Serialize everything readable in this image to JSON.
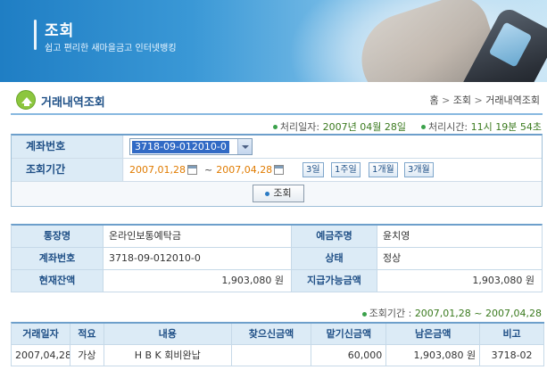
{
  "banner": {
    "title": "조회",
    "subtitle": "쉽고 편리한 새마을금고 인터넷뱅킹"
  },
  "page": {
    "title": "거래내역조회",
    "breadcrumb": {
      "home": "홈",
      "sep1": ">",
      "level1": "조회",
      "sep2": ">",
      "level2": "거래내역조회"
    }
  },
  "process": {
    "date_label": "처리일자:",
    "date_value": "2007년 04월 28일",
    "time_label": "처리시간:",
    "time_value": "11시 19분 54초"
  },
  "search": {
    "account_label": "계좌번호",
    "account_selected": "3718-09-012010-0",
    "period_label": "조회기간",
    "start_date": "2007,01,28",
    "tilde": "~",
    "end_date": "2007,04,28",
    "period_buttons": [
      "3일",
      "1주일",
      "1개월",
      "3개월"
    ],
    "query_button": "조회"
  },
  "account": {
    "passbook_label": "통장명",
    "passbook_value": "온라인보통예탁금",
    "owner_label": "예금주명",
    "owner_value": "윤치영",
    "account_label": "계좌번호",
    "account_value": "3718-09-012010-0",
    "status_label": "상태",
    "status_value": "정상",
    "balance_label": "현재잔액",
    "balance_value": "1,903,080 원",
    "available_label": "지급가능금액",
    "available_value": "1,903,080 원"
  },
  "period_line": {
    "label": "조회기간 :",
    "value": "2007,01,28 ~ 2007,04,28"
  },
  "transactions": {
    "headers": [
      "거래일자",
      "적요",
      "내용",
      "찾으신금액",
      "맡기신금액",
      "남은금액",
      "비고"
    ],
    "rows": [
      [
        "2007,04,28",
        "가상",
        "H B K 회비완납",
        "",
        "60,000",
        "1,903,080 원",
        "3718-02"
      ]
    ]
  },
  "colors": {
    "accent": "#1d4f86",
    "header_bg": "#dcebf6",
    "date_orange": "#e07b00",
    "value_green": "#3a7a1e"
  }
}
